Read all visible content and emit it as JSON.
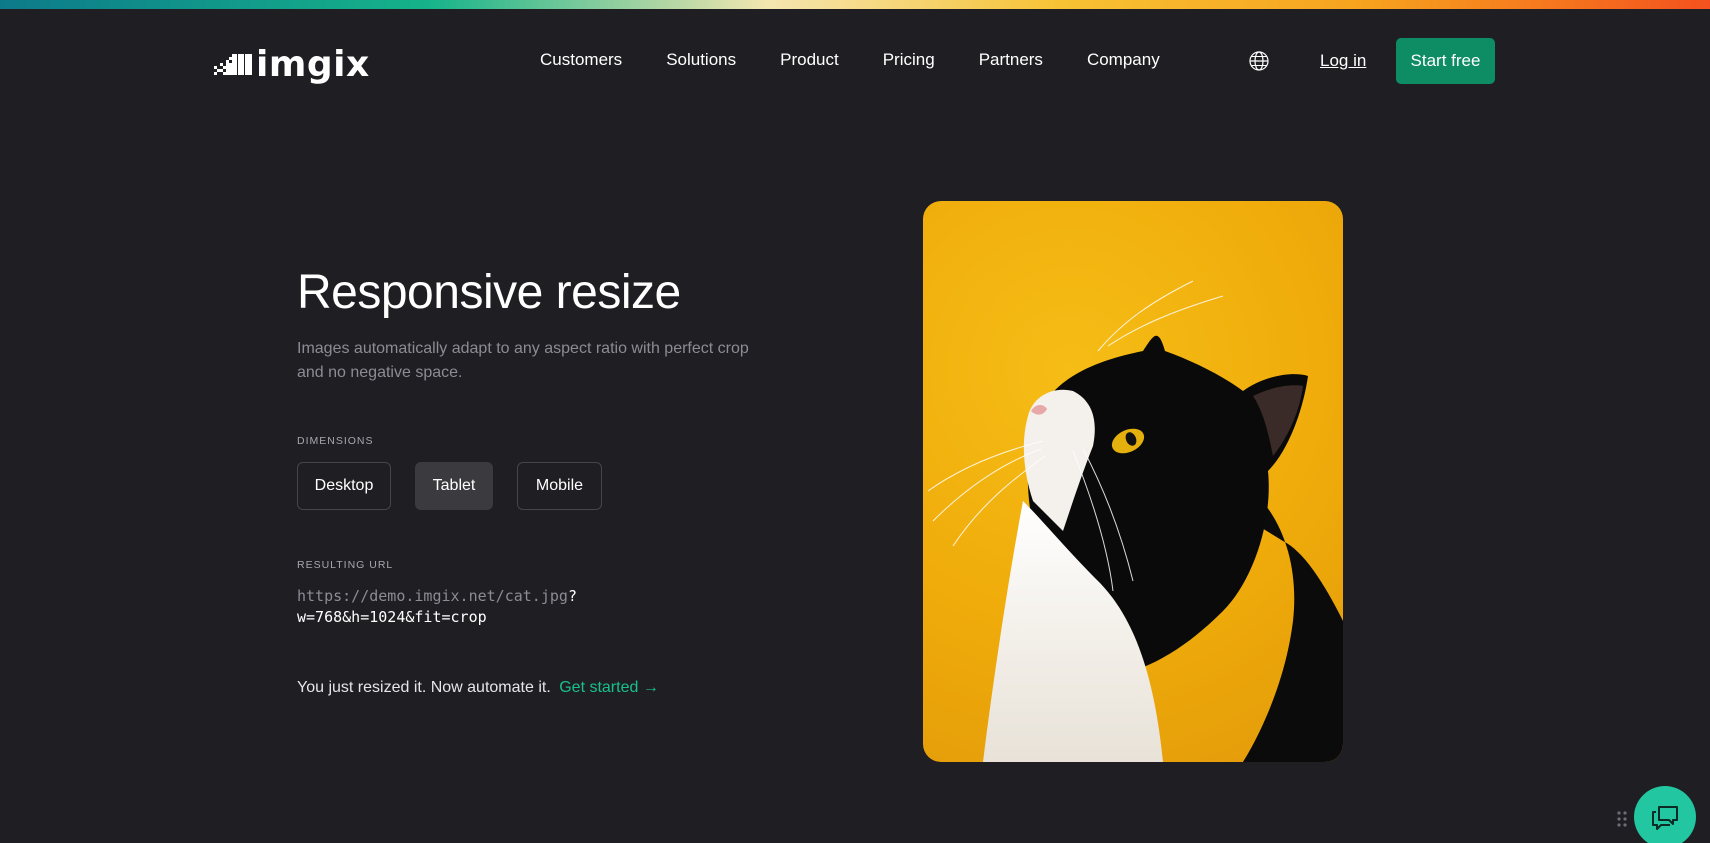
{
  "brand": {
    "name": "imgix",
    "accent": "#0e8c63",
    "link_color": "#19c08a",
    "chat_color": "#22c6a0"
  },
  "nav": {
    "items": [
      {
        "label": "Customers"
      },
      {
        "label": "Solutions"
      },
      {
        "label": "Product"
      },
      {
        "label": "Pricing"
      },
      {
        "label": "Partners"
      },
      {
        "label": "Company"
      }
    ],
    "language_icon": "globe-icon",
    "login_label": "Log in",
    "start_label": "Start free"
  },
  "hero": {
    "title": "Responsive resize",
    "subtitle": "Images automatically adapt to any aspect ratio with perfect crop and no negative space.",
    "dimensions_label": "DIMENSIONS",
    "dimensions": [
      {
        "label": "Desktop",
        "selected": false
      },
      {
        "label": "Tablet",
        "selected": true
      },
      {
        "label": "Mobile",
        "selected": false
      }
    ],
    "resulting_url_label": "RESULTING URL",
    "url_base": "https://demo.imgix.net/cat.jpg",
    "url_query_start": "?",
    "url_query": "w=768&h=1024&fit=crop",
    "cta_text": "You just resized it. Now automate it.",
    "cta_link": "Get started →"
  },
  "photo": {
    "subject": "black and white cat looking up on yellow background"
  },
  "widgets": {
    "chat_icon": "chat-bubbles-icon",
    "handle_icon": "drag-dots-icon"
  }
}
